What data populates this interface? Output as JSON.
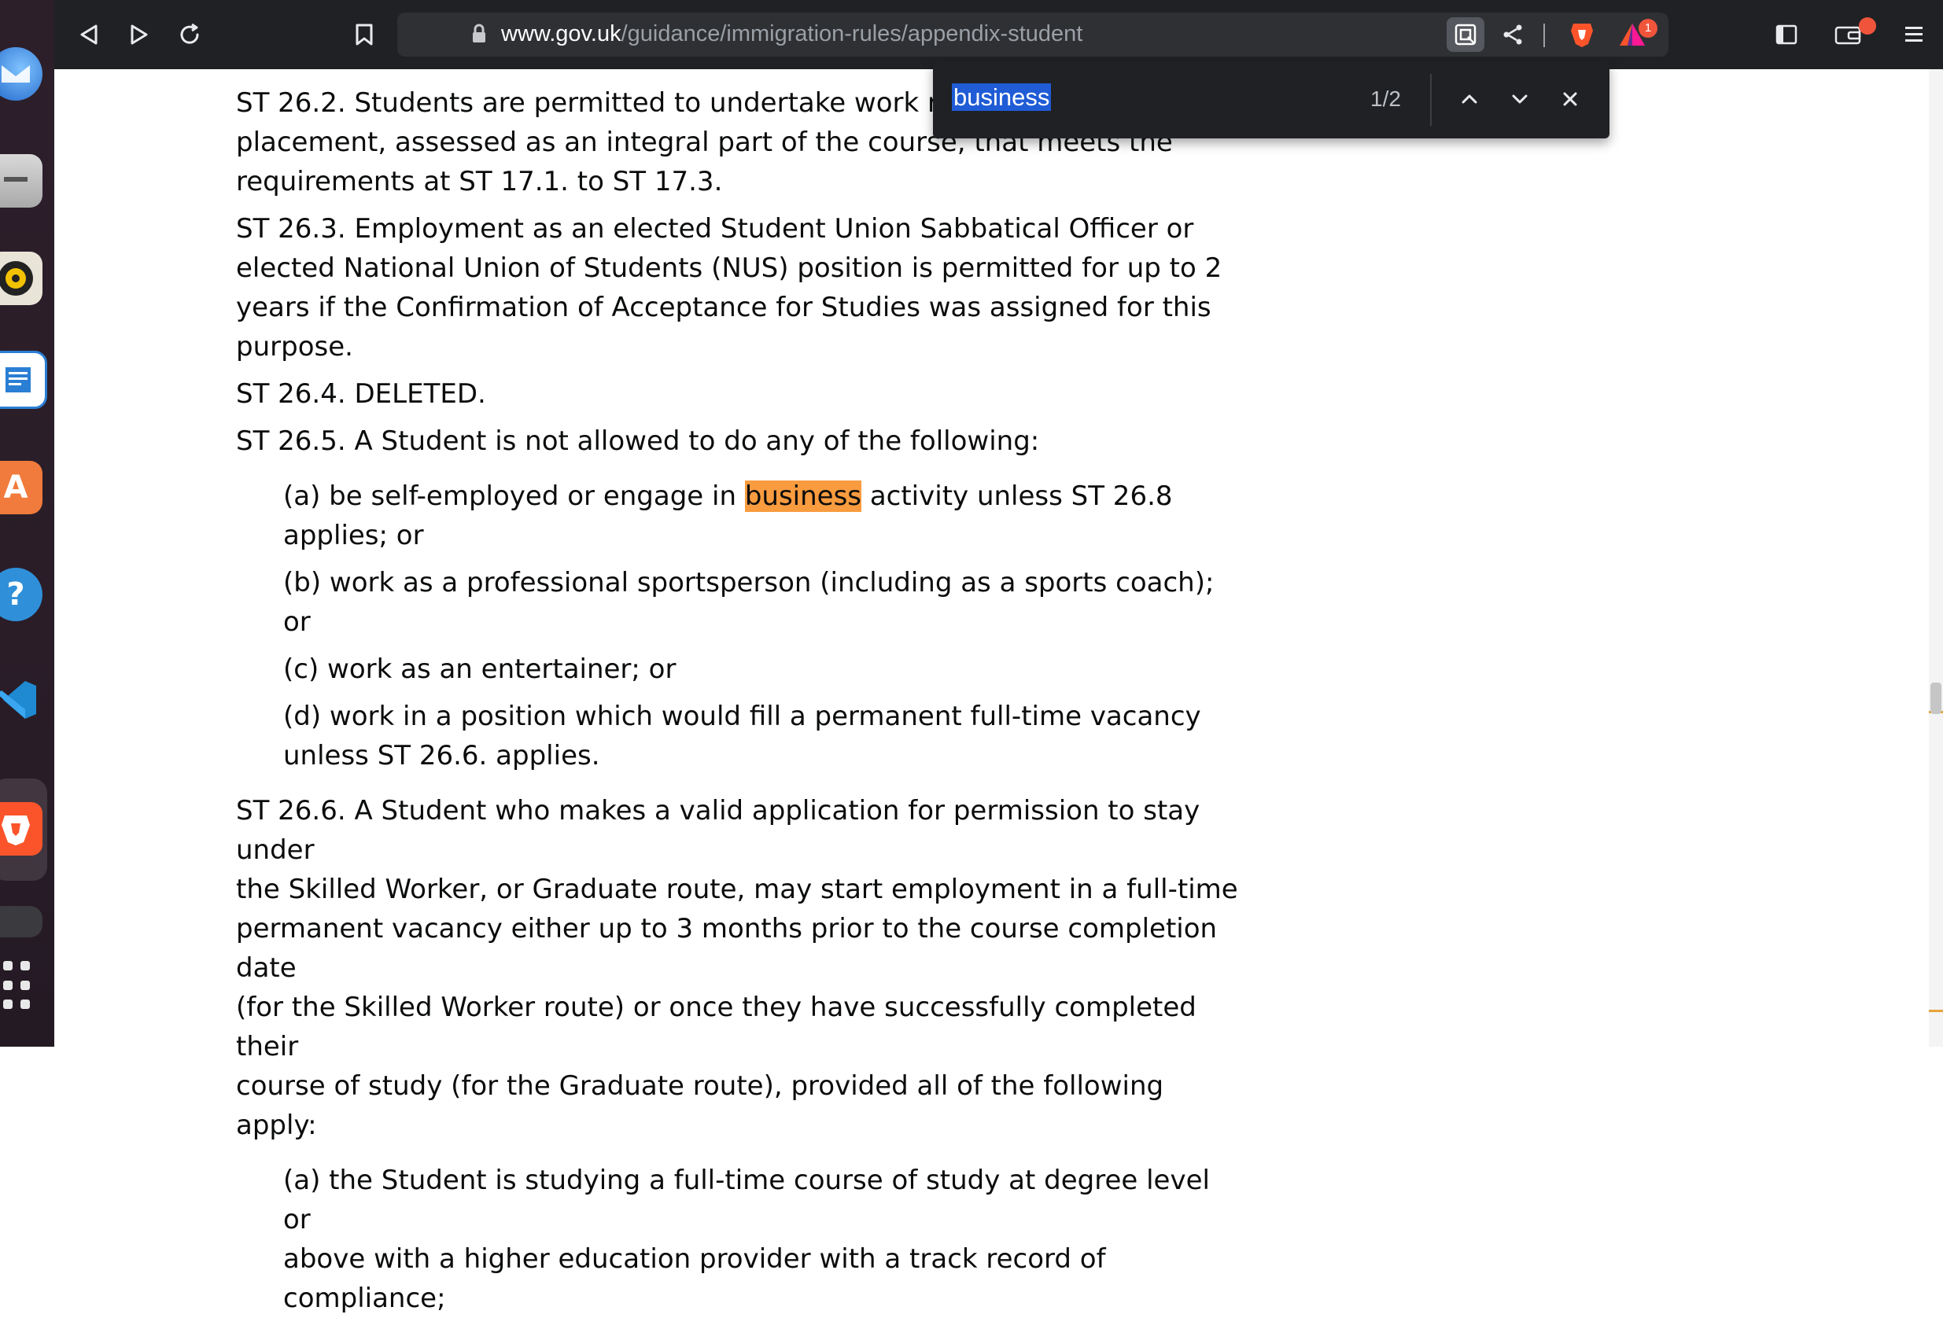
{
  "browser": {
    "url_host": "www.gov.uk",
    "url_path": "/guidance/immigration-rules/appendix-student",
    "rewards_badge": "1"
  },
  "find_bar": {
    "query": "business",
    "match_count": "1/2"
  },
  "colors": {
    "toolbar_bg": "#202124",
    "highlight_current": "#f99b3f",
    "find_selection": "#1f5cd6",
    "brave_orange": "#fb542b"
  },
  "content": {
    "st26_2_a": "ST 26.2. Students are permitted to undertake work rel",
    "st26_2_b": "placement, assessed as an integral part of the course, that meets the",
    "st26_2_c": "requirements at ST 17.1. to ST 17.3.",
    "st26_3_a": "ST 26.3. Employment as an elected Student Union Sabbatical Officer or",
    "st26_3_b": "elected National Union of Students (NUS) position is permitted for up to 2",
    "st26_3_c": "years if the Confirmation of Acceptance for Studies was assigned for this",
    "st26_3_d": "purpose.",
    "st26_4": "ST 26.4. DELETED.",
    "st26_5": "ST 26.5. A Student is not allowed to do any of the following:",
    "st26_5_a_pre": "(a) be self-employed or engage in ",
    "st26_5_a_mark": "business",
    "st26_5_a_post": " activity unless ST 26.8",
    "st26_5_a_cont": "applies; or",
    "st26_5_b": "(b) work as a professional sportsperson (including as a sports coach); or",
    "st26_5_c": "(c) work as an entertainer; or",
    "st26_5_d_a": "(d) work in a position which would fill a permanent full-time vacancy",
    "st26_5_d_b": "unless ST 26.6. applies.",
    "st26_6_a": "ST 26.6. A Student who makes a valid application for permission to stay under",
    "st26_6_b": "the Skilled Worker, or Graduate route, may start employment in a full-time",
    "st26_6_c": "permanent vacancy either up to 3 months prior to the course completion date",
    "st26_6_d": "(for the Skilled Worker route) or once they have successfully completed their",
    "st26_6_e": "course of study (for the Graduate route), provided all of the following apply:",
    "st26_6_a1": "(a) the Student is studying a full-time course of study at degree level or",
    "st26_6_a2": "above with a higher education provider with a track record of compliance;"
  }
}
